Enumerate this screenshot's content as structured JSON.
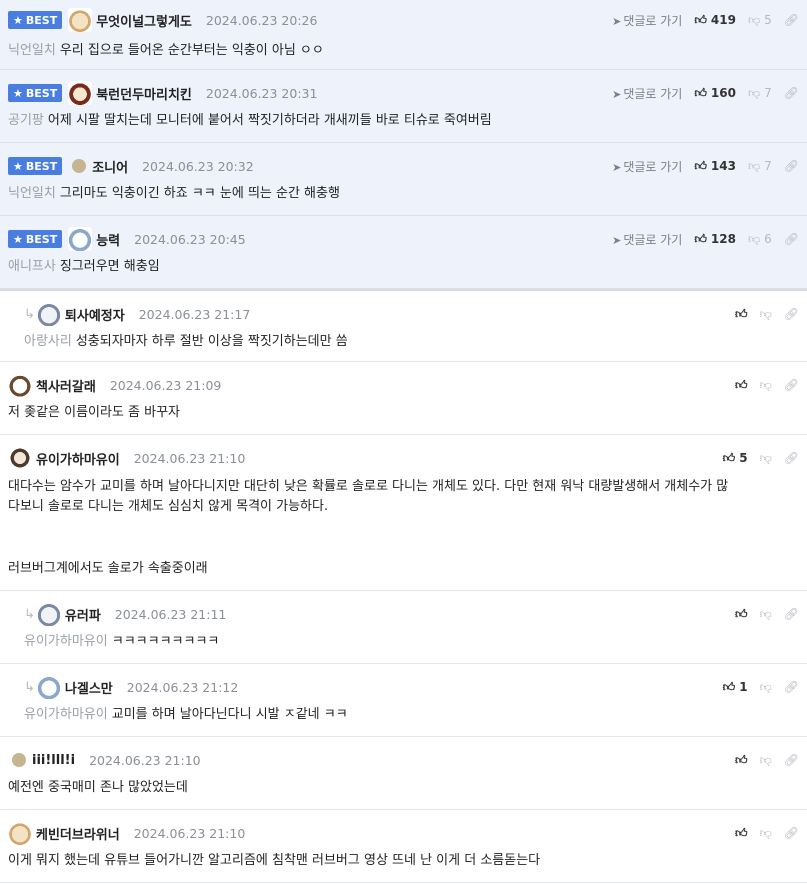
{
  "best_label": "BEST",
  "goto_label": "댓글로 가기",
  "comments": [
    {
      "nick": "무엇이널그렇게도",
      "date": "2024.06.23 20:26",
      "mention": "닉언일치",
      "text": "우리 집으로 들어온 순간부터는 익충이 아님 ㅇㅇ",
      "up": "419",
      "down": "5"
    },
    {
      "nick": "북런던두마리치킨",
      "date": "2024.06.23 20:31",
      "mention": "공기팡",
      "text": "어제 시팔 딸치는데 모니터에 붙어서 짝짓기하더라 개새끼들 바로 티슈로 죽여버림",
      "up": "160",
      "down": "7"
    },
    {
      "nick": "조니어",
      "date": "2024.06.23 20:32",
      "mention": "닉언일치",
      "text": "그리마도 익충이긴 하죠 ㅋㅋ 눈에 띄는 순간 해충행",
      "up": "143",
      "down": "7"
    },
    {
      "nick": "능력",
      "date": "2024.06.23 20:45",
      "mention": "애니프사",
      "text": "징그러우면 해충임",
      "up": "128",
      "down": "6"
    },
    {
      "nick": "퇴사예정자",
      "date": "2024.06.23 21:17",
      "mention": "아랑사리",
      "text": "성충되자마자 하루 절반 이상을 짝짓기하는데만 씀",
      "up": ""
    },
    {
      "nick": "책사러갈래",
      "date": "2024.06.23 21:09",
      "text": "저 좆같은 이름이라도 좀 바꾸자",
      "up": ""
    },
    {
      "nick": "유이가하마유이",
      "date": "2024.06.23 21:10",
      "line1": "대다수는 암수가 교미를 하며 날아다니지만 대단히 낮은 확률로 솔로로 다니는 개체도 있다. 다만 현재 워낙 대량발생해서 개체수가 많",
      "line2": "다보니 솔로로 다니는 개체도 심심치 않게 목격이 가능하다.",
      "line3": "러브버그계에서도 솔로가 속출중이래",
      "up": "5"
    },
    {
      "nick": "유러파",
      "date": "2024.06.23 21:11",
      "mention": "유이가하마유이",
      "text": "ㅋㅋㅋㅋㅋㅋㅋㅋㅋ",
      "up": ""
    },
    {
      "nick": "나겔스만",
      "date": "2024.06.23 21:12",
      "mention": "유이가하마유이",
      "text": "교미를 하며 날아다닌다니 시발 ㅈ같네 ㅋㅋ",
      "up": "1"
    },
    {
      "nick": "iii!lll!i",
      "date": "2024.06.23 21:10",
      "text": "예전엔 중국매미 존나 많았었는데",
      "up": ""
    },
    {
      "nick": "케빈더브라위너",
      "date": "2024.06.23 21:10",
      "text": "이게 뭐지 했는데 유튜브 들어가니깐 알고리즘에 침착맨 러브버그 영상 뜨네 난 이게 더 소름돋는다",
      "up": ""
    }
  ]
}
